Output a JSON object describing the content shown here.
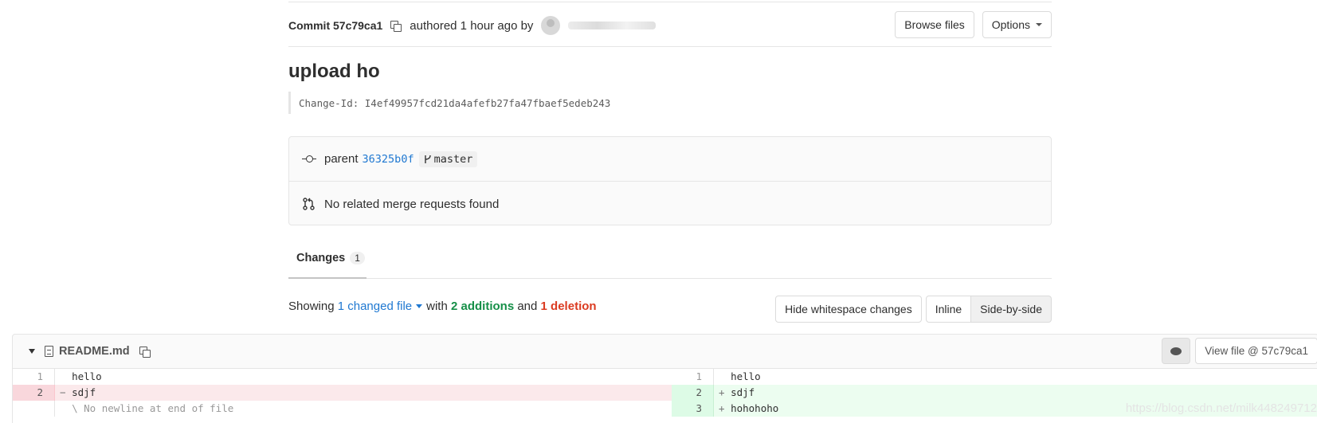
{
  "commit": {
    "label": "Commit 57c79ca1",
    "authored": "authored 1 hour ago by",
    "browse_files": "Browse files",
    "options": "Options"
  },
  "title": "upload ho",
  "change_id": "Change-Id: I4ef49957fcd21da4afefb27fa47fbaef5edeb243",
  "info": {
    "parent_label": "parent",
    "parent_sha": "36325b0f",
    "branch": "master",
    "merge_requests": "No related merge requests found"
  },
  "tabs": {
    "changes_label": "Changes",
    "changes_count": "1"
  },
  "summary": {
    "showing": "Showing",
    "changed": "1 changed file",
    "with": "with",
    "additions": "2 additions",
    "and": "and",
    "deletions": "1 deletion"
  },
  "view_buttons": {
    "hide_whitespace": "Hide whitespace changes",
    "inline": "Inline",
    "side_by_side": "Side-by-side"
  },
  "file": {
    "name": "README.md",
    "view_file": "View file @ 57c79ca1"
  },
  "diff": {
    "left": [
      {
        "num": "1",
        "marker": " ",
        "text": "hello",
        "type": "context"
      },
      {
        "num": "2",
        "marker": "−",
        "text": "sdjf",
        "type": "old"
      },
      {
        "num": "",
        "marker": " ",
        "text": "\\ No newline at end of file",
        "type": "meta"
      }
    ],
    "right": [
      {
        "num": "1",
        "marker": " ",
        "text": "hello",
        "type": "context"
      },
      {
        "num": "2",
        "marker": "+",
        "text": "sdjf",
        "type": "new"
      },
      {
        "num": "3",
        "marker": "+",
        "text": "hohohoho",
        "type": "new"
      }
    ]
  },
  "watermark": "https://blog.csdn.net/milk448249712",
  "colors": {
    "link": "#1f78d1",
    "addition": "#168f48",
    "deletion": "#db3b21"
  },
  "icons": [
    "copy-icon",
    "avatar",
    "chevron-down-icon",
    "commit-icon",
    "branch-icon",
    "merge-request-icon",
    "file-icon",
    "comment-icon"
  ]
}
